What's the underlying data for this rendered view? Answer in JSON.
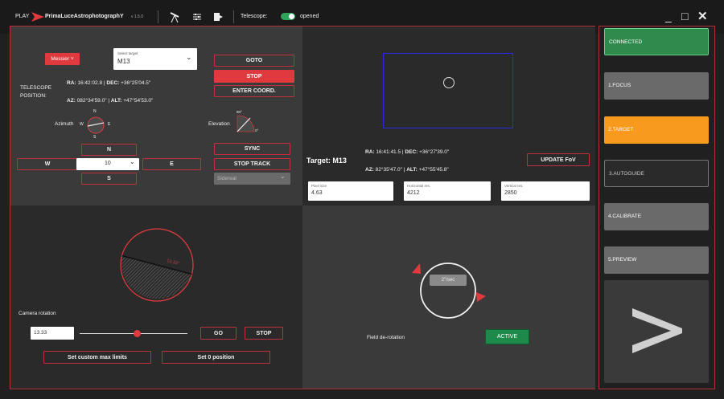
{
  "titlebar": {
    "play": "PLAY",
    "brand": "PrimaLuceAstrophotographY",
    "version": "v 1.5.0",
    "telescope_label": "Telescope:",
    "telescope_status": "opened",
    "minimize": "_",
    "maximize": "□",
    "close": "✕"
  },
  "target_panel": {
    "catalog_button": "Messier ˅",
    "select_label": "Select target",
    "select_value": "M13",
    "goto": "GOTO",
    "stop": "STOP",
    "enter_coord": "ENTER COORD.",
    "telescope_position_line1": "TELESCOPE",
    "telescope_position_line2": "POSITION:",
    "ra_label": "RA:",
    "ra_value": "16:42:02.8",
    "dec_label": "DEC:",
    "dec_value": "+36°25'04.5\"",
    "az_label": "AZ:",
    "az_value": "082°34'59.0\"",
    "alt_label": "ALT:",
    "alt_value": "+47°54'53.0\"",
    "azimuth_label": "Azimuth",
    "compass_n": "N",
    "compass_s": "S",
    "compass_w": "W",
    "compass_e": "E",
    "elevation_label": "Elevation",
    "elev_90": "90°",
    "elev_0": "0°",
    "sync": "SYNC",
    "stop_track": "STOP TRACK",
    "tracking_mode": "Sidereal",
    "dir_n": "N",
    "dir_w": "W",
    "dir_e": "E",
    "dir_s": "S",
    "speed_value": "10"
  },
  "fov_panel": {
    "target_title": "Target: M13",
    "ra_label": "RA:",
    "ra_value": "16:41:41.5",
    "dec_label": "DEC:",
    "dec_value": "+36°27'39.0\"",
    "az_label": "AZ:",
    "az_value": "82°35'47.0\"",
    "alt_label": "ALT:",
    "alt_value": "+47°55'45.8\"",
    "update_fov": "UPDATE FoV",
    "pixel_size_label": "Pixel size",
    "pixel_size_value": "4.63",
    "hres_label": "Horizontal res.",
    "hres_value": "4212",
    "vres_label": "Vertical res.",
    "vres_value": "2850"
  },
  "rotation_panel": {
    "angle_display": "13.33°",
    "camera_rotation_label": "Camera rotation",
    "rotation_value": "13.33",
    "slider_fraction": 0.5,
    "go": "GO",
    "stop": "STOP",
    "set_custom_limits": "Set custom max limits",
    "set_zero": "Set 0 position"
  },
  "derotation_panel": {
    "speed": "2\"/sec",
    "label": "Field de-rotation",
    "active": "ACTIVE"
  },
  "sidebar": {
    "items": [
      {
        "label": "CONNECTED",
        "state": "connected"
      },
      {
        "label": "1.FOCUS",
        "state": "idle"
      },
      {
        "label": "2.TARGET",
        "state": "active"
      },
      {
        "label": "3.AUTOGUIDE",
        "state": "disabled"
      },
      {
        "label": "4.CALIBRATE",
        "state": "idle"
      },
      {
        "label": "5.PREVIEW",
        "state": "idle"
      }
    ],
    "next_icon": "chevron-right-icon"
  },
  "colors": {
    "accent_red": "#e03a3f",
    "connected_green": "#2f8a4d",
    "target_orange": "#f79a1e",
    "active_green": "#1e8a4a"
  }
}
